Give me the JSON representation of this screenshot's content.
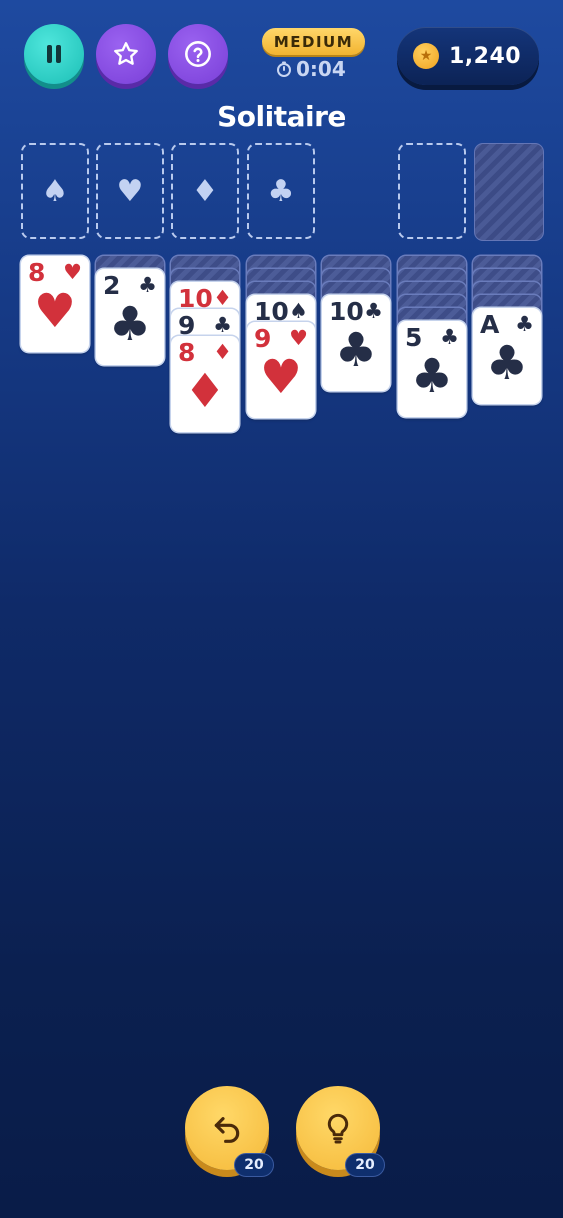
{
  "header": {
    "pause_icon": "pause-icon",
    "star_icon": "star-icon",
    "help_icon": "question-icon",
    "difficulty": "MEDIUM",
    "timer": "0:04",
    "coins": "1,240"
  },
  "title": "Solitaire",
  "foundations": [
    {
      "suit": "♠",
      "icon": "spade-icon"
    },
    {
      "suit": "♥",
      "icon": "heart-icon"
    },
    {
      "suit": "♦",
      "icon": "diamond-icon"
    },
    {
      "suit": "♣",
      "icon": "club-icon"
    }
  ],
  "tableau": [
    {
      "hidden": 0,
      "cards": [
        {
          "rank": "8",
          "suit": "♥",
          "color": "red"
        }
      ]
    },
    {
      "hidden": 1,
      "cards": [
        {
          "rank": "2",
          "suit": "♣",
          "color": "dark"
        }
      ]
    },
    {
      "hidden": 2,
      "cards": [
        {
          "rank": "10",
          "suit": "♦",
          "color": "red"
        },
        {
          "rank": "9",
          "suit": "♣",
          "color": "dark"
        },
        {
          "rank": "8",
          "suit": "♦",
          "color": "red"
        }
      ]
    },
    {
      "hidden": 3,
      "cards": [
        {
          "rank": "10",
          "suit": "♠",
          "color": "dark"
        },
        {
          "rank": "9",
          "suit": "♥",
          "color": "red"
        }
      ]
    },
    {
      "hidden": 3,
      "cards": [
        {
          "rank": "10",
          "suit": "♣",
          "color": "dark"
        }
      ]
    },
    {
      "hidden": 5,
      "cards": [
        {
          "rank": "5",
          "suit": "♣",
          "color": "dark"
        }
      ]
    },
    {
      "hidden": 4,
      "cards": [
        {
          "rank": "A",
          "suit": "♣",
          "color": "dark"
        }
      ]
    }
  ],
  "actions": {
    "undo": {
      "icon": "undo-icon",
      "count": "20"
    },
    "hint": {
      "icon": "lightbulb-icon",
      "count": "20"
    }
  },
  "colors": {
    "accent_teal": "#1cbfb6",
    "accent_purple": "#7a3fd8",
    "gold": "#f5b939",
    "card_red": "#d2313b",
    "card_dark": "#252e47"
  }
}
